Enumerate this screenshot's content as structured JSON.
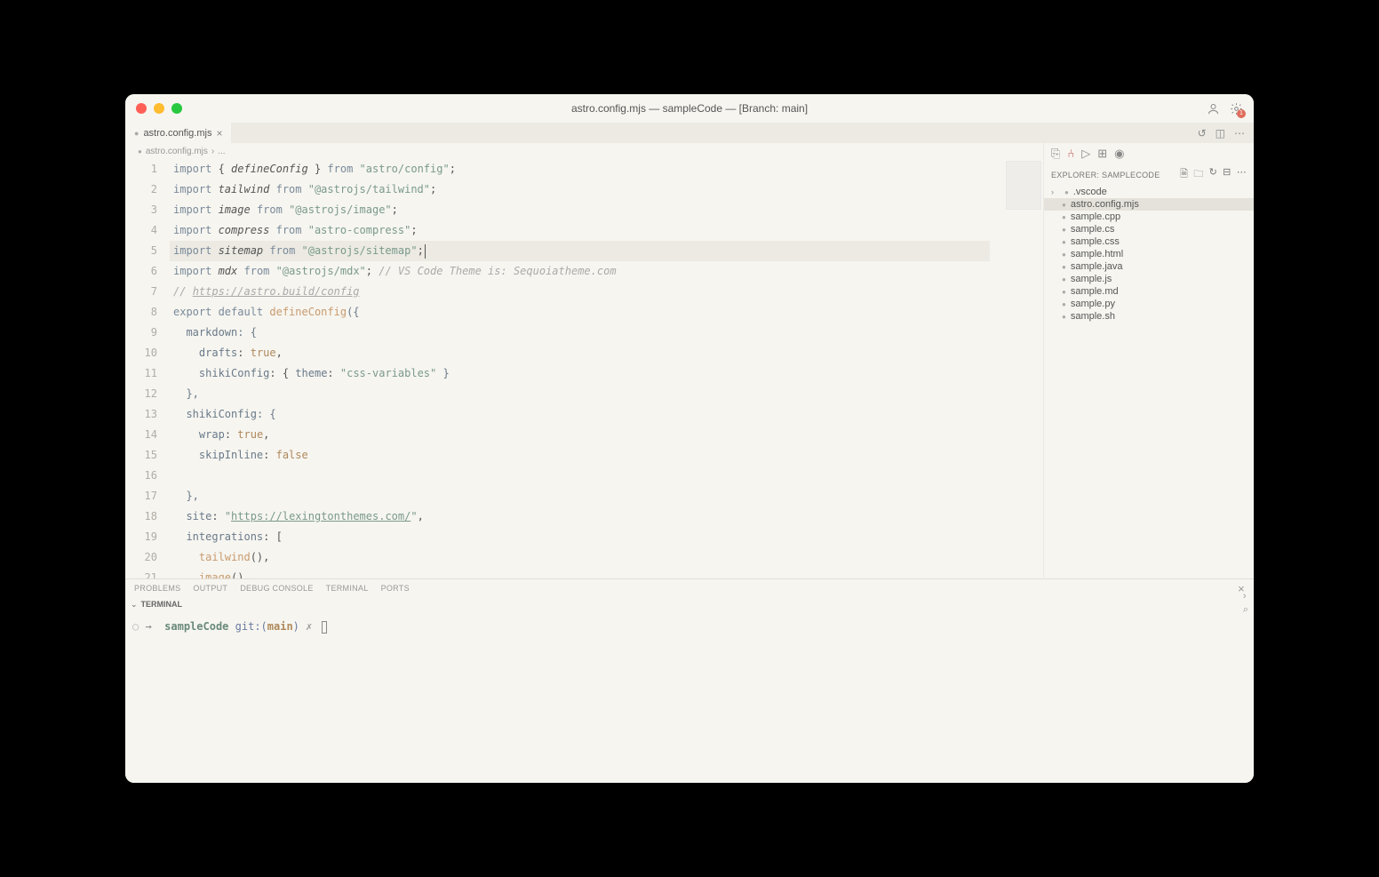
{
  "window": {
    "title": "astro.config.mjs — sampleCode — [Branch: main]"
  },
  "tab": {
    "name": "astro.config.mjs"
  },
  "breadcrumb": {
    "file": "astro.config.mjs",
    "sep": "›",
    "more": "..."
  },
  "explorer": {
    "title": "EXPLORER: SAMPLECODE",
    "items": [
      {
        "name": ".vscode",
        "folder": true
      },
      {
        "name": "astro.config.mjs",
        "selected": true
      },
      {
        "name": "sample.cpp"
      },
      {
        "name": "sample.cs"
      },
      {
        "name": "sample.css"
      },
      {
        "name": "sample.html"
      },
      {
        "name": "sample.java"
      },
      {
        "name": "sample.js"
      },
      {
        "name": "sample.md"
      },
      {
        "name": "sample.py"
      },
      {
        "name": "sample.sh"
      }
    ]
  },
  "panel": {
    "tabs": [
      "PROBLEMS",
      "OUTPUT",
      "DEBUG CONSOLE",
      "TERMINAL",
      "PORTS"
    ],
    "sub": "TERMINAL"
  },
  "terminal": {
    "circle": "○",
    "arrow": "→",
    "path": "sampleCode",
    "gitpre": "git:(",
    "branch": "main",
    "gitpost": ")",
    "dirty": "✗"
  },
  "code": {
    "lines": [
      [
        {
          "t": "import ",
          "c": "kw"
        },
        {
          "t": "{ "
        },
        {
          "t": "defineConfig",
          "c": "it"
        },
        {
          "t": " } "
        },
        {
          "t": "from ",
          "c": "kw"
        },
        {
          "t": "\"astro/config\"",
          "c": "str"
        },
        {
          "t": ";"
        }
      ],
      [
        {
          "t": "import ",
          "c": "kw"
        },
        {
          "t": "tailwind",
          "c": "it"
        },
        {
          "t": " "
        },
        {
          "t": "from ",
          "c": "kw"
        },
        {
          "t": "\"@astrojs/tailwind\"",
          "c": "str"
        },
        {
          "t": ";"
        }
      ],
      [
        {
          "t": "import ",
          "c": "kw"
        },
        {
          "t": "image",
          "c": "it"
        },
        {
          "t": " "
        },
        {
          "t": "from ",
          "c": "kw"
        },
        {
          "t": "\"@astrojs/image\"",
          "c": "str"
        },
        {
          "t": ";"
        }
      ],
      [
        {
          "t": "import ",
          "c": "kw"
        },
        {
          "t": "compress",
          "c": "it"
        },
        {
          "t": " "
        },
        {
          "t": "from ",
          "c": "kw"
        },
        {
          "t": "\"astro-compress\"",
          "c": "str"
        },
        {
          "t": ";"
        }
      ],
      [
        {
          "t": "import ",
          "c": "kw"
        },
        {
          "t": "sitemap",
          "c": "it"
        },
        {
          "t": " "
        },
        {
          "t": "from ",
          "c": "kw"
        },
        {
          "t": "\"@astrojs/sitemap\"",
          "c": "str"
        },
        {
          "t": ";",
          "cur": true
        }
      ],
      [
        {
          "t": "import ",
          "c": "kw"
        },
        {
          "t": "mdx",
          "c": "it"
        },
        {
          "t": " "
        },
        {
          "t": "from ",
          "c": "kw"
        },
        {
          "t": "\"@astrojs/mdx\"",
          "c": "str"
        },
        {
          "t": "; "
        },
        {
          "t": "// VS Code Theme is: Sequoiatheme.com",
          "c": "cm"
        }
      ],
      [
        {
          "t": "// ",
          "c": "cm"
        },
        {
          "t": "https://astro.build/config",
          "c": "cm link"
        }
      ],
      [
        {
          "t": "export default ",
          "c": "kw"
        },
        {
          "t": "defineConfig",
          "c": "fn"
        },
        {
          "t": "({",
          "c": "prop"
        }
      ],
      [
        {
          "t": "  "
        },
        {
          "t": "markdown",
          "c": "prop"
        },
        {
          "t": ": {",
          "c": "prop"
        }
      ],
      [
        {
          "t": "    "
        },
        {
          "t": "drafts",
          "c": "prop"
        },
        {
          "t": ": "
        },
        {
          "t": "true",
          "c": "bool"
        },
        {
          "t": ","
        }
      ],
      [
        {
          "t": "    "
        },
        {
          "t": "shikiConfig",
          "c": "prop"
        },
        {
          "t": ": { "
        },
        {
          "t": "theme",
          "c": "prop"
        },
        {
          "t": ": "
        },
        {
          "t": "\"css-variables\"",
          "c": "str"
        },
        {
          "t": " }",
          "c": "prop"
        }
      ],
      [
        {
          "t": "  },",
          "c": "prop"
        }
      ],
      [
        {
          "t": "  "
        },
        {
          "t": "shikiConfig",
          "c": "prop"
        },
        {
          "t": ": {",
          "c": "prop"
        }
      ],
      [
        {
          "t": "    "
        },
        {
          "t": "wrap",
          "c": "prop"
        },
        {
          "t": ": "
        },
        {
          "t": "true",
          "c": "bool"
        },
        {
          "t": ","
        }
      ],
      [
        {
          "t": "    "
        },
        {
          "t": "skipInline",
          "c": "prop"
        },
        {
          "t": ": "
        },
        {
          "t": "false",
          "c": "bool"
        }
      ],
      [
        {
          "t": ""
        }
      ],
      [
        {
          "t": "  },",
          "c": "prop"
        }
      ],
      [
        {
          "t": "  "
        },
        {
          "t": "site",
          "c": "prop"
        },
        {
          "t": ": "
        },
        {
          "t": "\"",
          "c": "str"
        },
        {
          "t": "https://lexingtonthemes.com/",
          "c": "str link"
        },
        {
          "t": "\"",
          "c": "str"
        },
        {
          "t": ","
        }
      ],
      [
        {
          "t": "  "
        },
        {
          "t": "integrations",
          "c": "prop"
        },
        {
          "t": ": ["
        }
      ],
      [
        {
          "t": "    "
        },
        {
          "t": "tailwind",
          "c": "fn"
        },
        {
          "t": "(),"
        }
      ],
      [
        {
          "t": "    "
        },
        {
          "t": "image",
          "c": "fn"
        },
        {
          "t": "(),"
        }
      ]
    ],
    "highlighted": 5
  },
  "gear_badge": "1"
}
